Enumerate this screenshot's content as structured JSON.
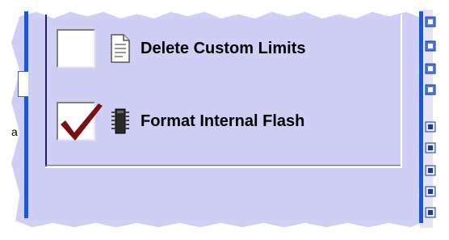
{
  "options": [
    {
      "label": "Delete Custom Limits",
      "checked": false,
      "icon": "document-icon"
    },
    {
      "label": "Format Internal Flash",
      "checked": true,
      "icon": "chip-icon"
    }
  ],
  "left_scrap_text": "a",
  "colors": {
    "panel": "#cfcff6",
    "accent_blue": "#1a56d8",
    "check": "#7a0f16"
  }
}
